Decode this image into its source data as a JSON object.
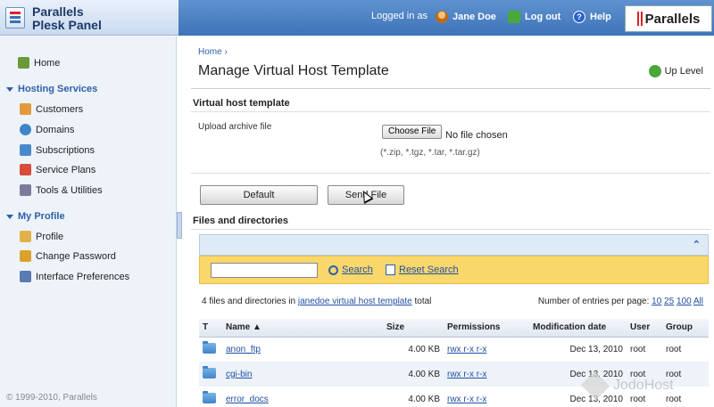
{
  "header": {
    "logo_line1": "Parallels",
    "logo_line2": "Plesk Panel",
    "logged_in_as": "Logged in as",
    "user": "Jane Doe",
    "logout": "Log out",
    "help": "Help",
    "brand": "Parallels"
  },
  "sidebar": {
    "home": "Home",
    "hosting_services": "Hosting Services",
    "customers": "Customers",
    "domains": "Domains",
    "subscriptions": "Subscriptions",
    "service_plans": "Service Plans",
    "tools": "Tools & Utilities",
    "my_profile": "My Profile",
    "profile": "Profile",
    "change_password": "Change Password",
    "interface_preferences": "Interface Preferences",
    "copyright": "© 1999-2010, Parallels"
  },
  "main": {
    "breadcrumb": "Home",
    "title": "Manage Virtual Host Template",
    "up_level": "Up Level",
    "section_vhost": "Virtual host template",
    "upload_label": "Upload archive file",
    "choose_file": "Choose File",
    "file_status": "No file chosen",
    "file_hint": "(*.zip, *.tgz, *.tar, *.tar.gz)",
    "default_btn": "Default",
    "send_file_btn": "Send File",
    "section_files": "Files and directories",
    "search_label": "Search",
    "reset_search_label": "Reset Search",
    "counts_prefix": "4 files and directories in",
    "counts_link": "janedoe virtual host template",
    "counts_suffix": "total",
    "per_page_label": "Number of entries per page:",
    "per_page_options": [
      "10",
      "25",
      "100",
      "All"
    ]
  },
  "table": {
    "headers": [
      "T",
      "Name",
      "Size",
      "Permissions",
      "Modification date",
      "User",
      "Group"
    ],
    "rows": [
      {
        "name": "anon_ftp",
        "size": "4.00 KB",
        "perm": "rwx r-x r-x",
        "date": "Dec 13, 2010",
        "user": "root",
        "group": "root"
      },
      {
        "name": "cgi-bin",
        "size": "4.00 KB",
        "perm": "rwx r-x r-x",
        "date": "Dec 13, 2010",
        "user": "root",
        "group": "root"
      },
      {
        "name": "error_docs",
        "size": "4.00 KB",
        "perm": "rwx r-x r-x",
        "date": "Dec 13, 2010",
        "user": "root",
        "group": "root"
      }
    ]
  },
  "watermark": "JodoHost",
  "colors": {
    "accent": "#2d5fa8",
    "search_bar": "#fad76b",
    "header_blue": "#3d73b8"
  }
}
